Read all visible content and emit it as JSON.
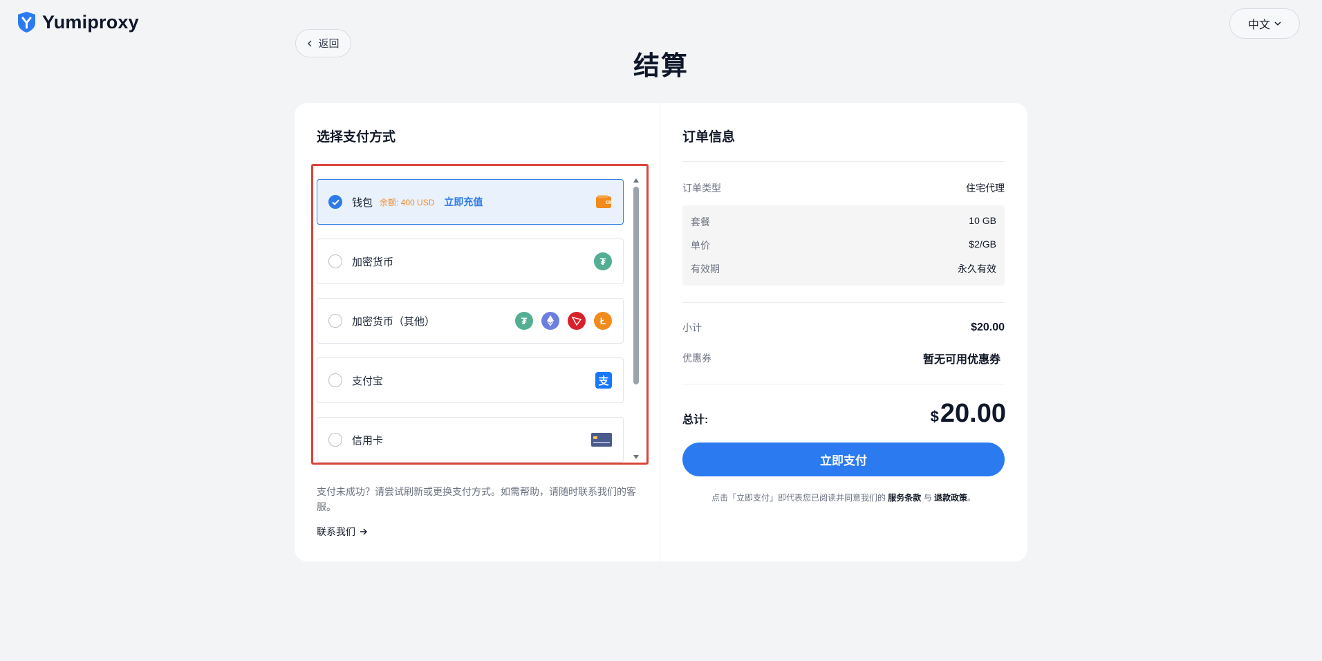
{
  "header": {
    "brand": "Yumiproxy",
    "language": "中文",
    "back_label": "返回",
    "page_title": "结算"
  },
  "payment": {
    "title": "选择支付方式",
    "methods": [
      {
        "label": "钱包",
        "balance": "余额: 400 USD",
        "topup": "立即充值",
        "selected": true,
        "icons": [
          "wallet-icon"
        ]
      },
      {
        "label": "加密货币",
        "selected": false,
        "icons": [
          "tether-icon"
        ]
      },
      {
        "label": "加密货币（其他）",
        "selected": false,
        "icons": [
          "tether-icon",
          "ethereum-icon",
          "tron-icon",
          "litecoin-icon"
        ]
      },
      {
        "label": "支付宝",
        "selected": false,
        "icons": [
          "alipay-icon"
        ]
      },
      {
        "label": "信用卡",
        "selected": false,
        "icons": [
          "credit-card-icon"
        ]
      }
    ],
    "help_text": "支付未成功？请尝试刷新或更换支付方式。如需帮助，请随时联系我们的客服。",
    "contact_label": "联系我们"
  },
  "order": {
    "title": "订单信息",
    "type_label": "订单类型",
    "type_value": "住宅代理",
    "details": [
      {
        "label": "套餐",
        "value": "10 GB"
      },
      {
        "label": "单价",
        "value": "$2/GB"
      },
      {
        "label": "有效期",
        "value": "永久有效"
      }
    ],
    "subtotal_label": "小计",
    "subtotal_value": "$20.00",
    "coupon_label": "优惠券",
    "coupon_value": "暂无可用优惠券",
    "total_label": "总计:",
    "total_currency": "$",
    "total_amount": "20.00",
    "pay_button": "立即支付",
    "terms_prefix": "点击「立即支付」即代表您已阅读并同意我们的",
    "terms_link": "服务条款",
    "terms_and": "与",
    "refund_link": "退款政策",
    "terms_suffix": "。"
  },
  "colors": {
    "accent": "#2b7af0",
    "highlight_border": "#d9443a",
    "balance": "#f08c2c"
  }
}
